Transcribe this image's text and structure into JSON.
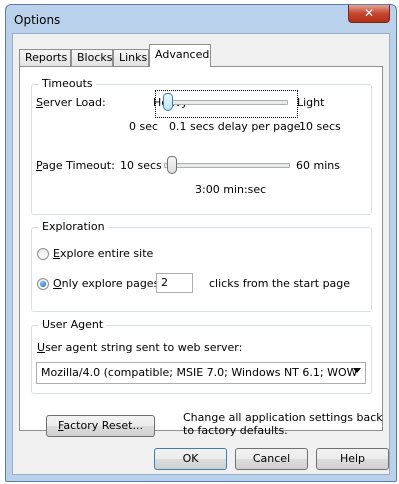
{
  "window": {
    "title": "Options",
    "close_glyph": "✕"
  },
  "tabs": [
    {
      "label": "Reports"
    },
    {
      "label": "Blocks"
    },
    {
      "label": "Links"
    },
    {
      "label": "Advanced",
      "active": true
    }
  ],
  "timeouts": {
    "title": "Timeouts",
    "server_load": {
      "label_u": "S",
      "label_rest": "erver Load:",
      "left": "Heavy",
      "right": "Light",
      "min": "0 sec",
      "value_text": "0.1 secs delay per page",
      "max": "10 secs",
      "level_fraction": 0.0
    },
    "page_timeout": {
      "label_u": "P",
      "label_rest": "age Timeout:",
      "left": "10 secs",
      "right": "60 mins",
      "value_text": "3:00 min:sec",
      "level_fraction": 0.05
    }
  },
  "exploration": {
    "title": "Exploration",
    "entire_site": {
      "u": "E",
      "rest": "xplore entire site",
      "checked": false
    },
    "only_pages": {
      "u": "O",
      "rest": "nly explore pages",
      "checked": true
    },
    "depth_value": "2",
    "depth_suffix": "clicks from the start page"
  },
  "user_agent": {
    "title": "User Agent",
    "label_u": "U",
    "label_rest": "ser agent string sent to web server:",
    "value": "Mozilla/4.0 (compatible; MSIE 7.0; Windows NT 6.1; WOW"
  },
  "factory_reset": {
    "button_u": "F",
    "button_rest": "actory Reset...",
    "description": [
      "Change all application settings back",
      "to factory defaults."
    ]
  },
  "footer": {
    "ok": "OK",
    "cancel": "Cancel",
    "help": "Help"
  }
}
